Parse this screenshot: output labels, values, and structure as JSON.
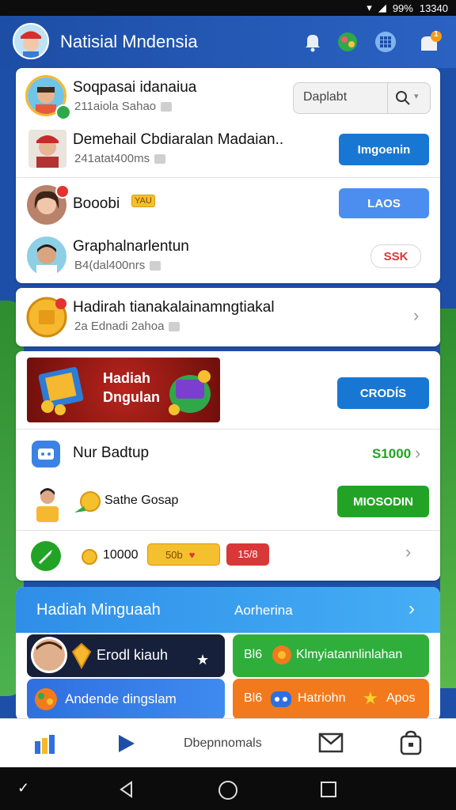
{
  "status_bar": {
    "signal": "99%",
    "time": "13340"
  },
  "header": {
    "title": "Natisial Mndensia",
    "icons": [
      "bell-icon",
      "globe-icon",
      "grid-icon",
      "notification-icon"
    ],
    "badge": "1"
  },
  "friends_card": {
    "search": {
      "placeholder": "Daplabt"
    },
    "rows": [
      {
        "name": "Soqpasai idanaiua",
        "sub": "211aiola Sahao",
        "button": ""
      },
      {
        "name": "Demehail Cbdiaralan Madaian..",
        "sub": "241atat400ms",
        "button": "Imgoenin"
      },
      {
        "name": "Booobi",
        "tag": "YAU",
        "sub": "",
        "button": "LAOS"
      },
      {
        "name": "Graphalnarlentun",
        "sub": "B4(dal400nrs",
        "button": "SSK"
      }
    ]
  },
  "reward_row": {
    "name": "Hadirah tianakalainamngtiakal",
    "sub": "2a Ednadi 2ahoa"
  },
  "promo_card": {
    "banner_line1": "Hadiah",
    "banner_line2": "Dngulan",
    "banner_button": "CRODÍS",
    "item1": {
      "label": "Nur Badtup",
      "value": "S1000"
    },
    "item2": {
      "label": "Sathe Gosap",
      "button": "MIOSODIN"
    },
    "item3": {
      "amount": "10000",
      "chip1": "50b",
      "chip2": "15/8"
    }
  },
  "bonus_section": {
    "title": "Hadiah Minguaah",
    "link": "Aorherina",
    "tiles": [
      {
        "label": "Erodl kiauh"
      },
      {
        "prefix": "Bl6",
        "label": "Klmyiatannlinlahan"
      },
      {
        "label": "Andende dingslam"
      },
      {
        "prefix": "Bl6",
        "label": "Hatriohn",
        "suffix": "Apos"
      }
    ]
  },
  "bottom_nav": {
    "items": [
      "home-icon",
      "play-icon",
      "Dbepnnomals",
      "mail-icon",
      "bag-icon"
    ],
    "center_label": "Dbepnnomals"
  },
  "colors": {
    "primary": "#1d4ea6",
    "blue_btn": "#1877d3",
    "green_btn": "#23a326",
    "red_btn": "#d93838",
    "yellow": "#f5b82e",
    "orange": "#f07a1c"
  }
}
